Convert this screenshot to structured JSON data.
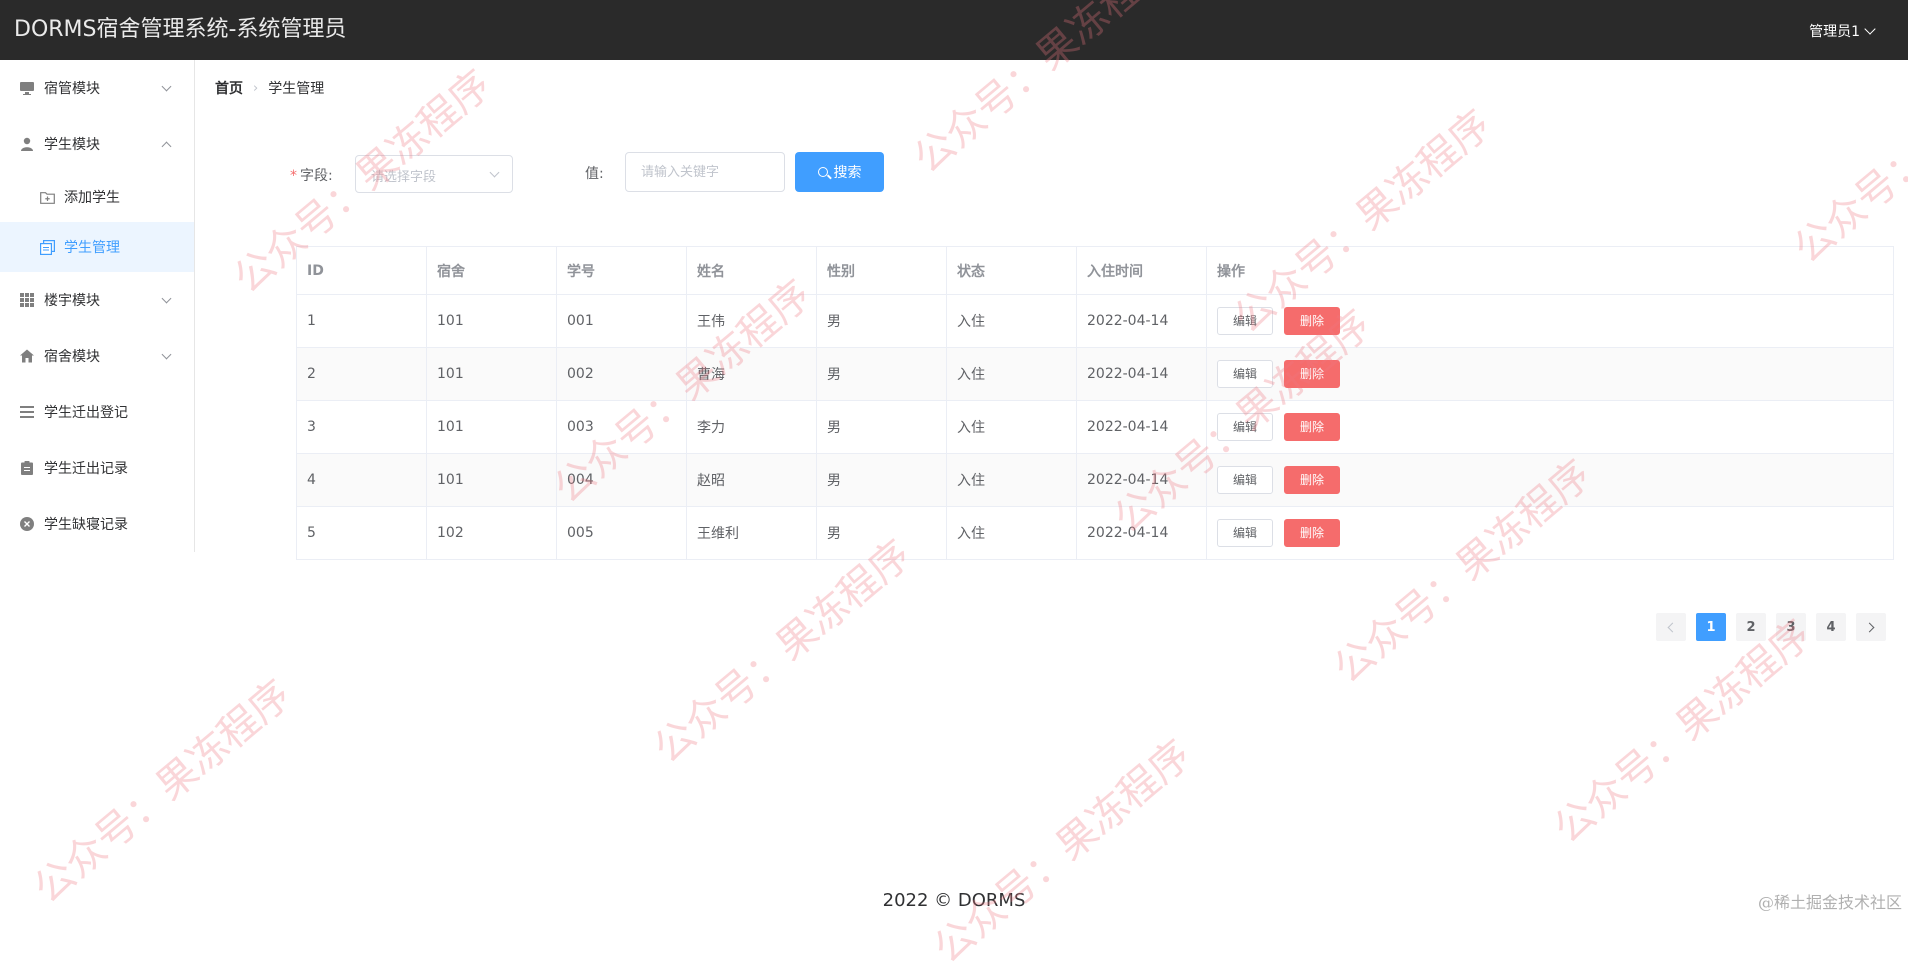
{
  "header": {
    "title": "DORMS宿舍管理系统-系统管理员",
    "user": "管理员1"
  },
  "sidebar": {
    "items": [
      {
        "label": "宿管模块",
        "icon": "monitor-icon",
        "expanded": false
      },
      {
        "label": "学生模块",
        "icon": "user-icon",
        "expanded": true,
        "children": [
          {
            "label": "添加学生",
            "icon": "folder-add-icon"
          },
          {
            "label": "学生管理",
            "icon": "document-copy-icon",
            "active": true
          }
        ]
      },
      {
        "label": "楼宇模块",
        "icon": "grid-icon",
        "expanded": false
      },
      {
        "label": "宿舍模块",
        "icon": "house-icon",
        "expanded": false
      },
      {
        "label": "学生迁出登记",
        "icon": "menu-lines-icon"
      },
      {
        "label": "学生迁出记录",
        "icon": "clipboard-icon"
      },
      {
        "label": "学生缺寝记录",
        "icon": "circle-close-icon"
      }
    ]
  },
  "breadcrumb": [
    "首页",
    "学生管理"
  ],
  "search": {
    "field_label": "字段:",
    "field_placeholder": "请选择字段",
    "value_label": "值:",
    "value_placeholder": "请输入关键字",
    "button": "搜索"
  },
  "table": {
    "columns": [
      "ID",
      "宿舍",
      "学号",
      "姓名",
      "性别",
      "状态",
      "入住时间",
      "操作"
    ],
    "rows": [
      [
        "1",
        "101",
        "001",
        "王伟",
        "男",
        "入住",
        "2022-04-14"
      ],
      [
        "2",
        "101",
        "002",
        "曹海",
        "男",
        "入住",
        "2022-04-14"
      ],
      [
        "3",
        "101",
        "003",
        "李力",
        "男",
        "入住",
        "2022-04-14"
      ],
      [
        "4",
        "101",
        "004",
        "赵昭",
        "男",
        "入住",
        "2022-04-14"
      ],
      [
        "5",
        "102",
        "005",
        "王维利",
        "男",
        "入住",
        "2022-04-14"
      ]
    ],
    "edit_label": "编辑",
    "delete_label": "删除"
  },
  "pagination": {
    "pages": [
      "1",
      "2",
      "3",
      "4"
    ],
    "current": "1"
  },
  "footer": "2022 © DORMS",
  "corner_mark": "@稀土掘金技术社区",
  "watermark": "公众号：果冻程序",
  "colors": {
    "primary": "#409eff",
    "danger": "#f56c6c",
    "header_bg": "#2a2a2a",
    "active_bg": "#ecf5ff"
  }
}
